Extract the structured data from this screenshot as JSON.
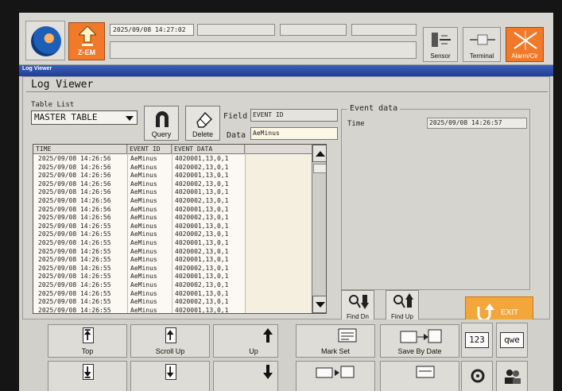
{
  "header": {
    "datetime": "2025/09/08 14:27:02",
    "zem_label": "Z-EM",
    "sensor_label": "Sensor",
    "terminal_label": "Terminal",
    "alarm_label": "Alarm/Clr"
  },
  "window": {
    "strip_title": "Log Viewer",
    "title": "Log Viewer"
  },
  "controls": {
    "table_list_label": "Table List",
    "table_selected": "MASTER TABLE",
    "query_label": "Query",
    "delete_label": "Delete",
    "field_label": "Field",
    "field_value": "EVENT ID",
    "data_label": "Data",
    "data_value": "AeMinus"
  },
  "event": {
    "group_title": "Event data",
    "time_label": "Time",
    "time_value": "2025/09/08 14:26:57"
  },
  "table": {
    "columns": [
      "TIME",
      "EVENT ID",
      "EVENT DATA"
    ],
    "rows": [
      [
        "2025/09/08 14:26:56",
        "AeMinus",
        "4020001,13,0,1"
      ],
      [
        "2025/09/08 14:26:56",
        "AeMinus",
        "4020002,13,0,1"
      ],
      [
        "2025/09/08 14:26:56",
        "AeMinus",
        "4020001,13,0,1"
      ],
      [
        "2025/09/08 14:26:56",
        "AeMinus",
        "4020002,13,0,1"
      ],
      [
        "2025/09/08 14:26:56",
        "AeMinus",
        "4020001,13,0,1"
      ],
      [
        "2025/09/08 14:26:56",
        "AeMinus",
        "4020002,13,0,1"
      ],
      [
        "2025/09/08 14:26:56",
        "AeMinus",
        "4020001,13,0,1"
      ],
      [
        "2025/09/08 14:26:56",
        "AeMinus",
        "4020002,13,0,1"
      ],
      [
        "2025/09/08 14:26:55",
        "AeMinus",
        "4020001,13,0,1"
      ],
      [
        "2025/09/08 14:26:55",
        "AeMinus",
        "4020002,13,0,1"
      ],
      [
        "2025/09/08 14:26:55",
        "AeMinus",
        "4020001,13,0,1"
      ],
      [
        "2025/09/08 14:26:55",
        "AeMinus",
        "4020002,13,0,1"
      ],
      [
        "2025/09/08 14:26:55",
        "AeMinus",
        "4020001,13,0,1"
      ],
      [
        "2025/09/08 14:26:55",
        "AeMinus",
        "4020002,13,0,1"
      ],
      [
        "2025/09/08 14:26:55",
        "AeMinus",
        "4020001,13,0,1"
      ],
      [
        "2025/09/08 14:26:55",
        "AeMinus",
        "4020002,13,0,1"
      ],
      [
        "2025/09/08 14:26:55",
        "AeMinus",
        "4020001,13,0,1"
      ],
      [
        "2025/09/08 14:26:55",
        "AeMinus",
        "4020002,13,0,1"
      ],
      [
        "2025/09/08 14:26:55",
        "AeMinus",
        "4020001,13,0,1"
      ]
    ]
  },
  "find": {
    "find_dn_label": "Find Dn",
    "find_up_label": "Find Up"
  },
  "exit_label": "EXIT",
  "toolbar": {
    "top_label": "Top",
    "scroll_up_label": "Scroll Up",
    "up_label": "Up",
    "mark_set_label": "Mark Set",
    "save_by_date_label": "Save By Date",
    "numeric_key": "123",
    "alpha_key": "qwe"
  },
  "colors": {
    "accent_orange": "#f07a2a",
    "exit_orange": "#f3a63a",
    "title_blue": "#1f3f95"
  }
}
